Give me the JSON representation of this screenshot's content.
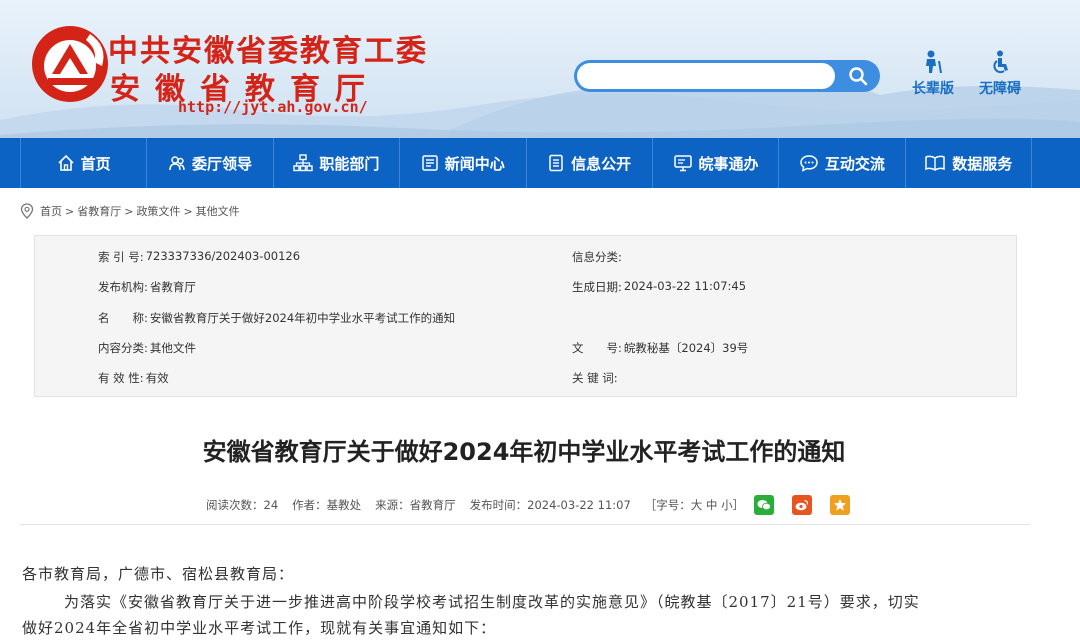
{
  "header": {
    "title_line1": "中共安徽省委教育工委",
    "title_line2": "安徽省教育厅",
    "url": "http://jyt.ah.gov.cn/",
    "search": {
      "placeholder": "",
      "value": ""
    },
    "tools": [
      {
        "label": "长辈版",
        "icon": "elder-icon"
      },
      {
        "label": "无障碍",
        "icon": "accessibility-icon"
      }
    ]
  },
  "nav": {
    "items": [
      {
        "label": "首页",
        "icon": "home-icon"
      },
      {
        "label": "委厅领导",
        "icon": "leaders-icon"
      },
      {
        "label": "职能部门",
        "icon": "org-icon"
      },
      {
        "label": "新闻中心",
        "icon": "news-icon"
      },
      {
        "label": "信息公开",
        "icon": "info-icon"
      },
      {
        "label": "皖事通办",
        "icon": "service-icon"
      },
      {
        "label": "互动交流",
        "icon": "chat-icon"
      },
      {
        "label": "数据服务",
        "icon": "data-icon"
      }
    ]
  },
  "breadcrumb": [
    "首页",
    ">",
    "省教育厅",
    ">",
    "政策文件",
    ">",
    "其他文件"
  ],
  "info": {
    "index_label": "索 引 号:",
    "index_value": "723337336/202403-00126",
    "category_label": "信息分类:",
    "category_value": "",
    "publisher_label": "发布机构:",
    "publisher_value": "省教育厅",
    "date_label": "生成日期:",
    "date_value": "2024-03-22 11:07:45",
    "name_label": "名　　称:",
    "name_value": "安徽省教育厅关于做好2024年初中学业水平考试工作的通知",
    "content_label": "内容分类:",
    "content_value": "其他文件",
    "docno_label": "文　　号:",
    "docno_value": "皖教秘基〔2024〕39号",
    "valid_label": "有 效 性:",
    "valid_value": "有效",
    "keywords_label": "关 键 词:",
    "keywords_value": ""
  },
  "article": {
    "title": "安徽省教育厅关于做好2024年初中学业水平考试工作的通知",
    "views": "阅读次数：24",
    "author": "作者：基教处",
    "source": "来源：省教育厅",
    "pubtime": "发布时间：2024-03-22 11:07",
    "fontsize": "［字号：大 中 小］",
    "para1": "各市教育局，广德市、宿松县教育局：",
    "para2_line1": "为落实《安徽省教育厅关于进一步推进高中阶段学校考试招生制度改革的实施意见》（皖教基〔2017〕21号）要求，切实",
    "para2_line2": "做好2024年全省初中学业水平考试工作，现就有关事宜通知如下："
  },
  "colors": {
    "brand_red": "#d42418",
    "nav_blue": "#0d63c4",
    "tool_blue": "#1a6fc4"
  }
}
